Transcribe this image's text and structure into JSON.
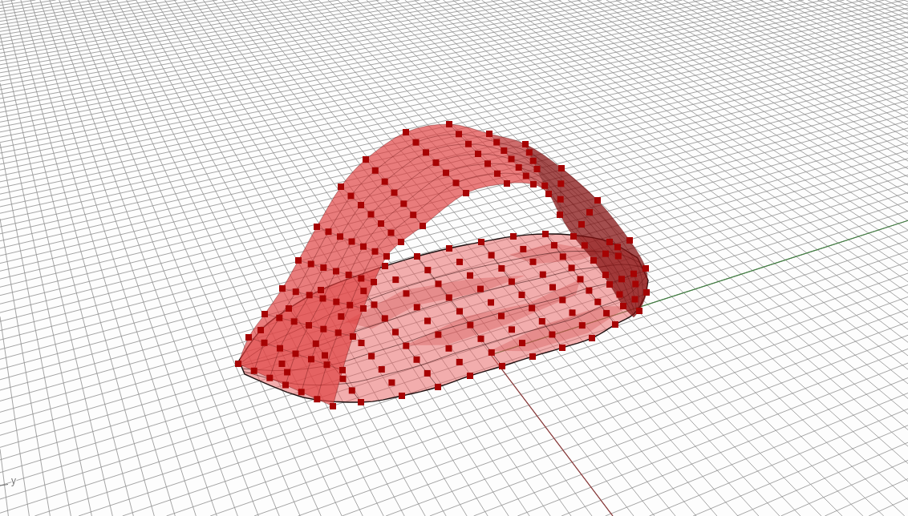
{
  "viewport": {
    "axis_icon": {
      "label": "y"
    }
  }
}
